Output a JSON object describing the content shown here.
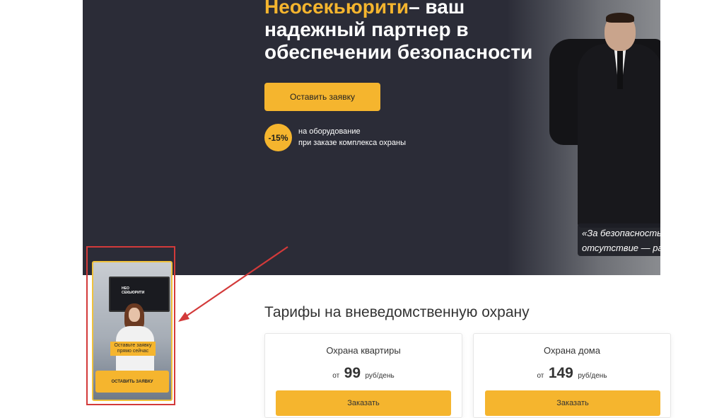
{
  "hero": {
    "title_accent": "Неосекьюрити",
    "title_line1_rest": "– ваш",
    "title_line2": "надежный партнер в",
    "title_line3": "обеспечении безопасности",
    "cta_label": "Оставить заявку",
    "discount": {
      "badge": "-15%",
      "line1": "на оборудование",
      "line2": "при заказе комплекса охраны"
    },
    "quote_line1": "«За безопасность н",
    "quote_line2": "отсутствие — рас"
  },
  "promo": {
    "tv_logo_line1": "НЕО",
    "tv_logo_line2": "СЕКЬЮРИТИ",
    "overlay_line1": "Оставьте заявку",
    "overlay_line2": "прямо сейчас",
    "button_label": "ОСТАВИТЬ ЗАЯВКУ"
  },
  "tariffs": {
    "title": "Тарифы на вневедомственную охрану",
    "cards": [
      {
        "name": "Охрана квартиры",
        "from": "от",
        "price": "99",
        "unit": "руб/день",
        "button": "Заказать"
      },
      {
        "name": "Охрана дома",
        "from": "от",
        "price": "149",
        "unit": "руб/день",
        "button": "Заказать"
      }
    ]
  },
  "colors": {
    "accent": "#f5b52e",
    "hero_bg": "#2b2c37",
    "highlight_red": "#d33a3a"
  }
}
